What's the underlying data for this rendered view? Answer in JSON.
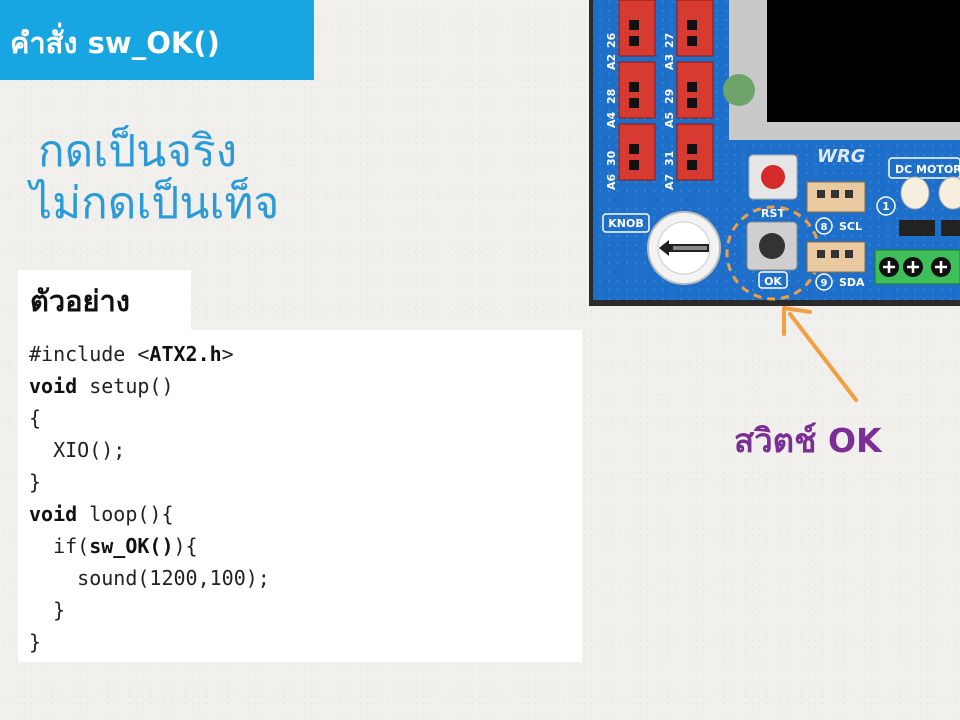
{
  "title": {
    "text": "คำสั่ง sw_OK()"
  },
  "headline": {
    "line1": "กดเป็นจริง",
    "line2": "ไม่กดเป็นเท็จ"
  },
  "example": {
    "label": "ตัวอย่าง",
    "code": {
      "l1_pre": "#include <",
      "l1_bold": "ATX2.h",
      "l1_post": ">",
      "l2_kw": "void",
      "l2_rest": " setup()",
      "l3": "{",
      "l4": "  XIO();",
      "l5": "}",
      "l6_kw": "void",
      "l6_rest": " loop(){",
      "l7_pre": "  if(",
      "l7_bold": "sw_OK()",
      "l7_post": "){",
      "l8": "    sound(1200,100);",
      "l9": "  }",
      "l10": "}"
    }
  },
  "board": {
    "pins": [
      {
        "num": "26",
        "label": "A2"
      },
      {
        "num": "27",
        "label": "A3"
      },
      {
        "num": "28",
        "label": "A4"
      },
      {
        "num": "29",
        "label": "A5"
      },
      {
        "num": "30",
        "label": "A6"
      },
      {
        "num": "31",
        "label": "A7"
      }
    ],
    "knob_label": "KNOB",
    "rst_label": "RST",
    "ok_label": "OK",
    "logo": "WRG",
    "dc_motor_label": "DC MOTOR",
    "motor_num": "1",
    "scl_num": "8",
    "scl_label": "SCL",
    "sda_num": "9",
    "sda_label": "SDA"
  },
  "callout": {
    "text": "สวิตช์ OK"
  },
  "colors": {
    "title_bg": "#18a6e3",
    "headline": "#2a9ad8",
    "callout": "#7b2e96",
    "arrow": "#f0a040",
    "board": "#1e6fc9"
  }
}
